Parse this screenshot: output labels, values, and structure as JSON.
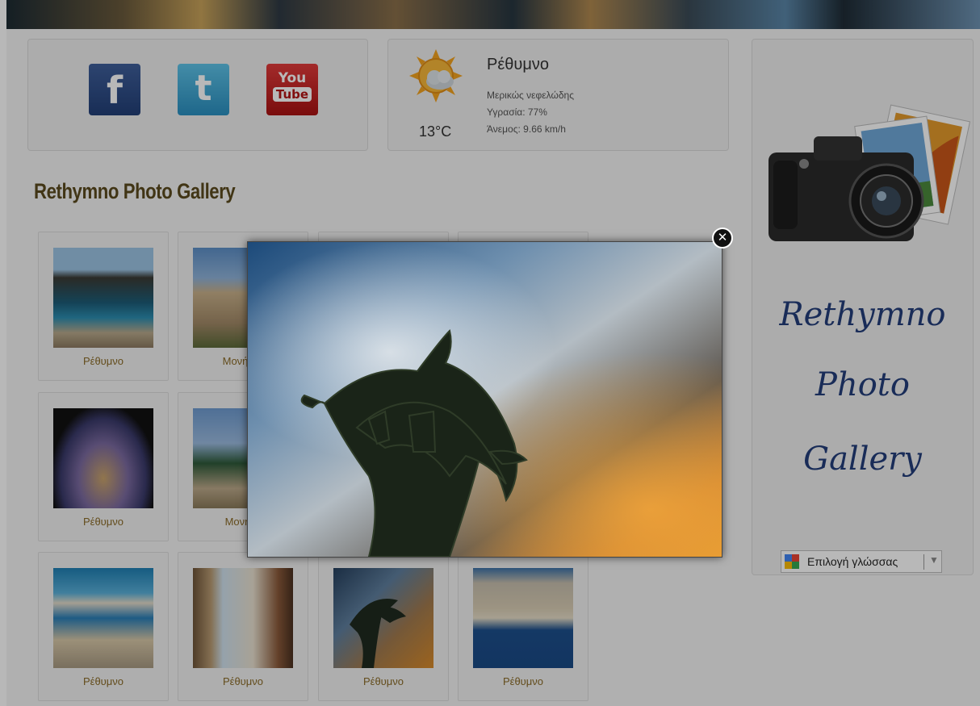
{
  "social": {
    "facebook_glyph": "f",
    "twitter_glyph": "t",
    "youtube_you": "You",
    "youtube_tube": "Tube"
  },
  "weather": {
    "city": "Ρέθυμνο",
    "condition": "Μερικώς νεφελώδης",
    "humidity": "Υγρασία: 77%",
    "wind": "Άνεμος: 9.66 km/h",
    "temperature": "13°C",
    "icon": "partly-cloudy-icon"
  },
  "gallery": {
    "title": "Rethymno Photo Gallery",
    "captions": [
      "Ρέθυμνο",
      "Μονή Αρ",
      "Ρέθυμνο",
      "Μονή Π",
      "Ρέθυμνο",
      "Ρέθυμνο",
      "Ρέθυμνο",
      "Ρέθυμνο"
    ]
  },
  "sidebar": {
    "line1": "Rethymno",
    "line2": "Photo",
    "line3": "Gallery",
    "language_select": "Επιλογή γλώσσας"
  },
  "lightbox": {
    "close_glyph": "✕"
  },
  "colors": {
    "accent_text": "#8a6a26",
    "sidebar_text": "#233e7a"
  }
}
